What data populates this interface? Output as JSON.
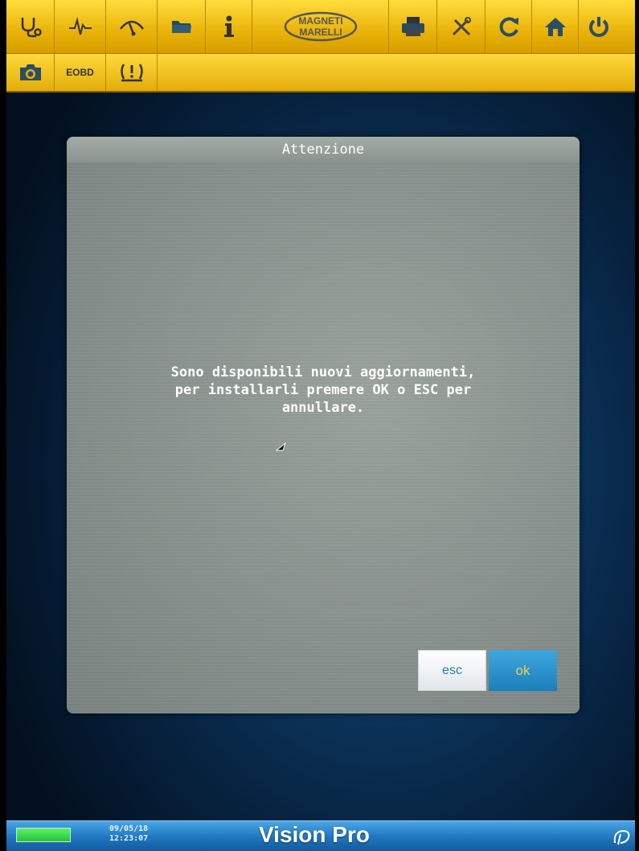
{
  "toolbar": {
    "buttons": [
      {
        "icon": "stethoscope-icon"
      },
      {
        "icon": "oscilloscope-icon"
      },
      {
        "icon": "gauge-icon"
      },
      {
        "icon": "folder-icon"
      },
      {
        "icon": "info-icon"
      },
      {
        "icon": "magneti-marelli-logo",
        "text": "MAGNETI MARELLI"
      },
      {
        "icon": "printer-icon"
      },
      {
        "icon": "tools-icon"
      },
      {
        "icon": "refresh-icon"
      },
      {
        "icon": "home-icon"
      },
      {
        "icon": "power-icon"
      }
    ]
  },
  "toolbar2": {
    "camera": "camera-icon",
    "eobd_label": "EOBD",
    "tpms": "tpms-warning-icon"
  },
  "dialog": {
    "title": "Attenzione",
    "message_lines": [
      "Sono disponibili nuovi aggiornamenti,",
      "per installarli premere OK o ESC per",
      "annullare."
    ],
    "esc_label": "esc",
    "ok_label": "ok"
  },
  "statusbar": {
    "date": "09/05/18",
    "time": "12:23:07",
    "brand": "Vision Pro",
    "battery_level": 1.0
  },
  "colors": {
    "toolbar": "#ecb70a",
    "ok_button": "#2a8fcb",
    "statusbar": "#1f76bf"
  }
}
